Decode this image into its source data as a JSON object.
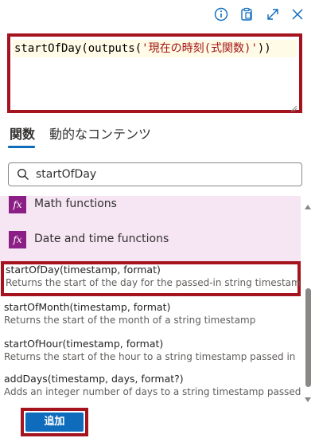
{
  "editor": {
    "expr_prefix": "startOfDay(outputs(",
    "expr_string": "'現在の時刻(式関数)'",
    "expr_suffix": "))"
  },
  "tabs": [
    {
      "label": "関数",
      "active": true
    },
    {
      "label": "動的なコンテンツ",
      "active": false
    }
  ],
  "search": {
    "value": "startOfDay"
  },
  "categories": [
    {
      "icon": "function-fx-icon",
      "label": "Math functions"
    },
    {
      "icon": "function-fx-icon",
      "label": "Date and time functions"
    }
  ],
  "functions": [
    {
      "signature": "startOfDay(timestamp, format)",
      "description": "Returns the start of the day for the passed-in string timestamp.",
      "selected": true
    },
    {
      "signature": "startOfMonth(timestamp, format)",
      "description": "Returns the start of the month of a string timestamp",
      "selected": false
    },
    {
      "signature": "startOfHour(timestamp, format)",
      "description": "Returns the start of the hour to a string timestamp passed in",
      "selected": false
    },
    {
      "signature": "addDays(timestamp, days, format?)",
      "description": "Adds an integer number of days to a string timestamp passed in",
      "selected": false
    }
  ],
  "footer": {
    "add_label": "追加"
  },
  "colors": {
    "accent": "#0f6cbd",
    "highlight_border": "#a4131e",
    "category_bg": "#f6e5f3",
    "fx_icon_bg": "#8b1f86"
  }
}
